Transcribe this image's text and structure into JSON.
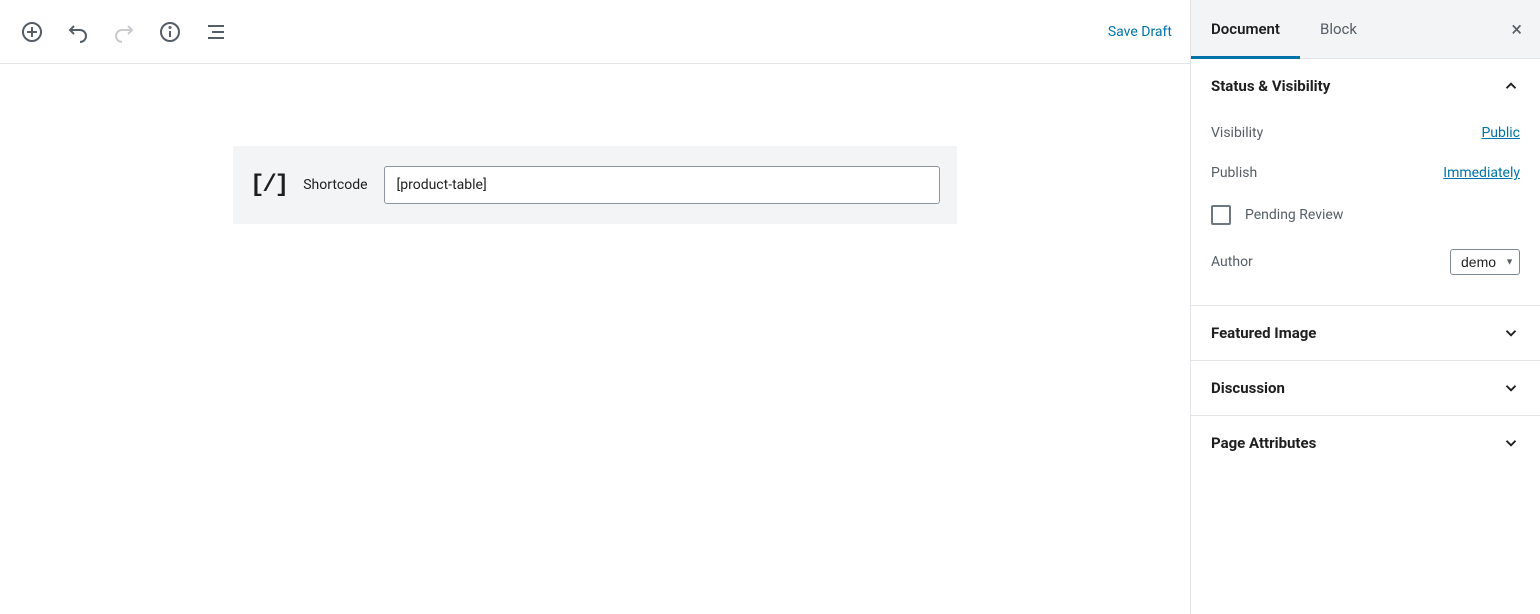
{
  "toolbar": {
    "save_draft": "Save Draft"
  },
  "block": {
    "label": "Shortcode",
    "value": "[product-table]"
  },
  "sidebar": {
    "tabs": {
      "document": "Document",
      "block": "Block"
    },
    "panels": {
      "status": {
        "title": "Status & Visibility",
        "visibility_label": "Visibility",
        "visibility_value": "Public",
        "publish_label": "Publish",
        "publish_value": "Immediately",
        "pending_review": "Pending Review",
        "author_label": "Author",
        "author_value": "demo"
      },
      "featured_image": "Featured Image",
      "discussion": "Discussion",
      "page_attributes": "Page Attributes"
    }
  }
}
